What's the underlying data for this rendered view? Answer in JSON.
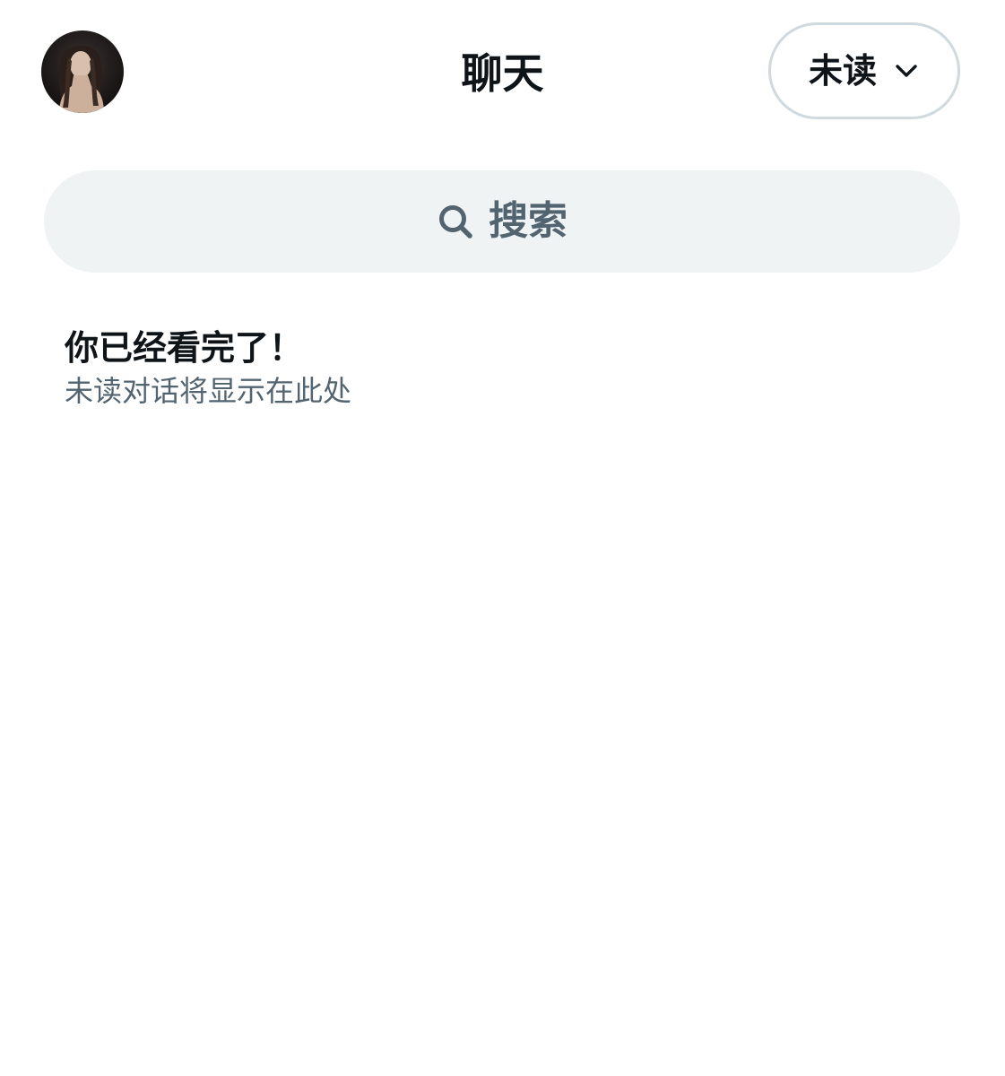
{
  "header": {
    "title": "聊天",
    "filter": {
      "label": "未读",
      "icon": "chevron-down-icon"
    },
    "avatar": {
      "icon": "user-avatar"
    }
  },
  "search": {
    "placeholder": "搜索",
    "icon": "search-icon"
  },
  "empty_state": {
    "title": "你已经看完了！",
    "subtitle": "未读对话将显示在此处"
  },
  "colors": {
    "primary_text": "#0f1419",
    "secondary_text": "#536471",
    "search_background": "#eff3f4",
    "border": "#cfd9de",
    "background": "#ffffff"
  }
}
